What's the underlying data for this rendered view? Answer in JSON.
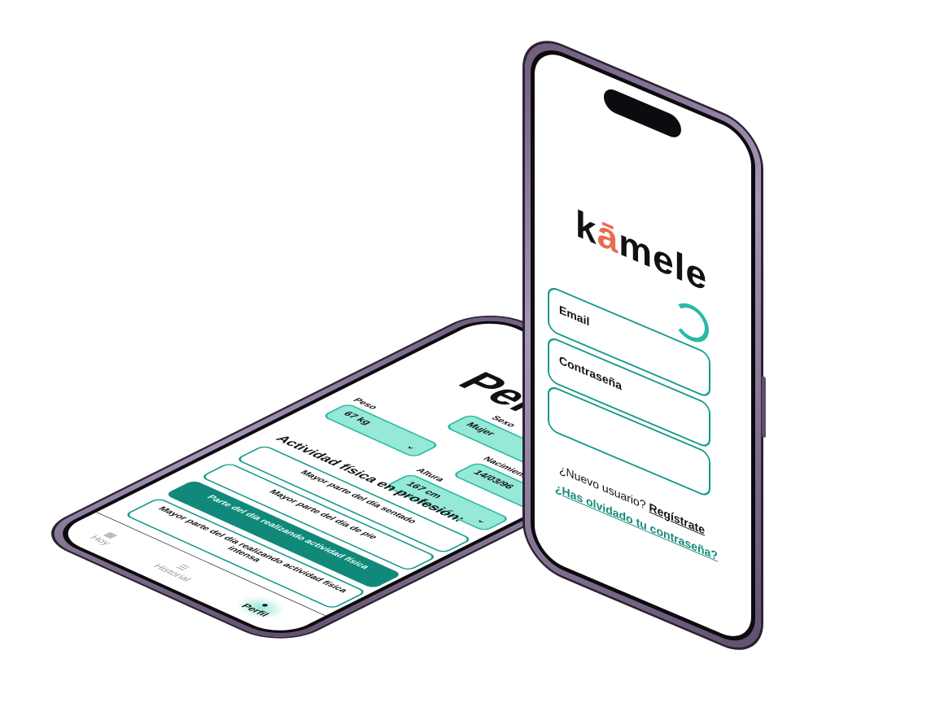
{
  "profile_screen": {
    "logo": "kamele",
    "title": "Perfil",
    "fields": [
      {
        "label": "Sexo",
        "value": "Mujer"
      },
      {
        "label": "Peso",
        "value": "67 kg"
      },
      {
        "label": "Nacimiento",
        "value": "14/03/96"
      },
      {
        "label": "Altura",
        "value": "167 cm"
      }
    ],
    "activity_heading": "Actividad física en profesión:",
    "activity_options": [
      {
        "label": "Mayor parte del día sentado",
        "selected": false
      },
      {
        "label": "Mayor parte del día de pie",
        "selected": false
      },
      {
        "label": "Parte del  día realizando actividad física",
        "selected": true
      },
      {
        "label": "Mayor parte del día realizando actividad física intensa",
        "selected": false
      }
    ],
    "nav": [
      {
        "label": "Hoy",
        "icon": "calendar-icon",
        "active": false
      },
      {
        "label": "Historial",
        "icon": "list-icon",
        "active": false
      },
      {
        "label": "Perfil",
        "icon": "user-icon",
        "active": true
      }
    ]
  },
  "login_screen": {
    "logo": "kamele",
    "email_placeholder": "Email",
    "password_placeholder": "Contraseña",
    "new_user_text": "¿Nuevo usuario?",
    "register_link": "Regístrate",
    "forgot_link": "¿Has olvidado tu contraseña?"
  },
  "colors": {
    "accent": "#11897a",
    "light_accent": "#95e9d6",
    "logo_orange": "#e96b53",
    "frame": "#a898b8"
  }
}
